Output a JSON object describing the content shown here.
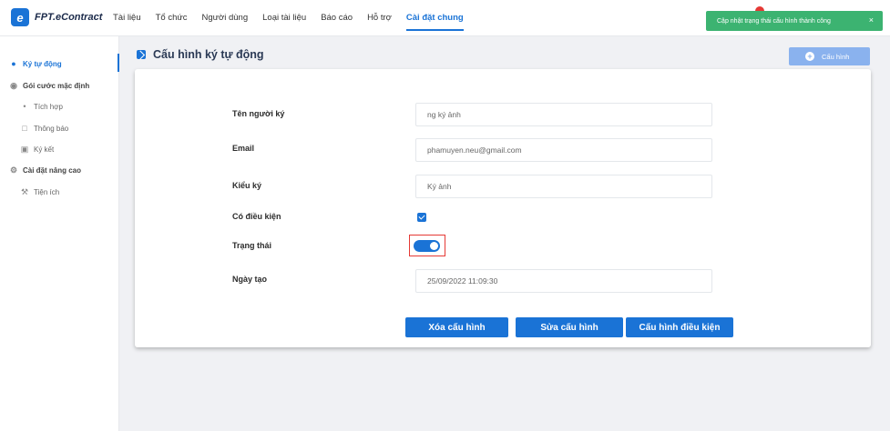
{
  "app": {
    "logo_mark": "e",
    "logo_text": "FPT.eContract"
  },
  "nav": {
    "items": [
      {
        "label": "Tài liệu"
      },
      {
        "label": "Tổ chức"
      },
      {
        "label": "Người dùng"
      },
      {
        "label": "Loại tài liệu"
      },
      {
        "label": "Báo cáo"
      },
      {
        "label": "Hỗ trợ"
      },
      {
        "label": "Cài đặt chung",
        "active": true
      }
    ]
  },
  "toast": {
    "message": "Cập nhật trạng thái cấu hình thành công",
    "close": "×"
  },
  "sidebar": {
    "items": [
      {
        "label": "Ký tự động",
        "icon": "user-icon"
      },
      {
        "label": "Gói cước mặc định",
        "icon": "package-icon"
      },
      {
        "label": "Tích hợp",
        "icon": "integration-icon"
      },
      {
        "label": "Thông báo",
        "icon": "notification-icon"
      },
      {
        "label": "Ký kết",
        "icon": "sign-icon"
      },
      {
        "label": "Cài đặt nâng cao",
        "icon": "settings-icon"
      },
      {
        "label": "Tiện ích",
        "icon": "wrench-icon"
      }
    ]
  },
  "page": {
    "title": "Cấu hình ký tự động",
    "config_button": "Cấu hình",
    "config_button_icon": "+"
  },
  "form": {
    "signer_label": "Tên người ký",
    "signer_value": "ng ký ảnh",
    "email_label": "Email",
    "email_value": "phamuyen.neu@gmail.com",
    "sign_type_label": "Kiểu ký",
    "sign_type_value": "Ký ảnh",
    "conditional_label": "Có điều kiện",
    "conditional_checked": true,
    "status_label": "Trạng thái",
    "status_on": true,
    "created_label": "Ngày tạo",
    "created_value": "25/09/2022 11:09:30"
  },
  "actions": {
    "delete": "Xóa cấu hình",
    "edit": "Sửa cấu hình",
    "condition": "Cấu hình điều kiện"
  },
  "colors": {
    "primary": "#1a73d6",
    "toast": "#3cb371",
    "highlight": "#e53935"
  }
}
